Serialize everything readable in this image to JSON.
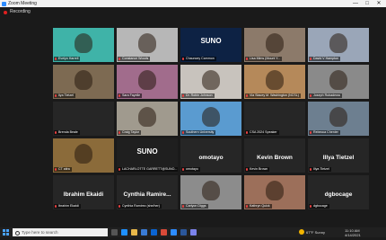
{
  "window": {
    "title": "Zoom Meeting",
    "minimize": "—",
    "maximize": "□",
    "close": "✕"
  },
  "recording": {
    "label": "Recording",
    "color": "#e02020"
  },
  "tiles": [
    {
      "name": "Evelyn Harrell",
      "kind": "photo",
      "bg": "#3fb3a8"
    },
    {
      "name": "Constance Woods",
      "kind": "photo",
      "bg": "#b7b7b7"
    },
    {
      "name": "Chauncey Cammon",
      "kind": "logo",
      "bg": "#0d2244",
      "logo": "SUNO"
    },
    {
      "name": "Lisa Mims (Mount Y...",
      "kind": "photo",
      "bg": "#8c7a6a"
    },
    {
      "name": "David V Hampton",
      "kind": "photo",
      "bg": "#9aa6b8"
    },
    {
      "name": "Ilya Tietzel",
      "kind": "photo",
      "bg": "#7d6a52"
    },
    {
      "name": "Sara Fayelle",
      "kind": "photo",
      "bg": "#a16c8c"
    },
    {
      "name": "Dr. Robin Johnson",
      "kind": "photo",
      "bg": "#c8c3bd"
    },
    {
      "name": "Via Stacey M. Washington (NCSL)",
      "kind": "photo",
      "bg": "#b5895a"
    },
    {
      "name": "Joseph Rubadewa",
      "kind": "photo",
      "bg": "#8a8a8a"
    },
    {
      "name": "Brenda Beale",
      "kind": "dark",
      "bg": "#1f1f1f"
    },
    {
      "name": "Craig Taylor",
      "kind": "photo",
      "bg": "#a09a8e"
    },
    {
      "name": "Southern University",
      "kind": "photo",
      "bg": "#5a9bd0"
    },
    {
      "name": "CSA 2024 Speaker",
      "kind": "dark",
      "bg": "#1f1f1f"
    },
    {
      "name": "Rebecca Chenier",
      "kind": "photo",
      "bg": "#6d7f90"
    },
    {
      "name": "CT atira",
      "kind": "photo",
      "bg": "#8b6b3a"
    },
    {
      "name": "LACHARLOTTE GARRETT@SUNO...",
      "kind": "logo",
      "bg": "#1f1f1f",
      "logo": "SUNO"
    },
    {
      "name": "omotayo",
      "kind": "name",
      "bg": "#1f1f1f",
      "big": "omotayo"
    },
    {
      "name": "Kevin Brown",
      "kind": "name",
      "bg": "#1f1f1f",
      "big": "Kevin Brown"
    },
    {
      "name": "Illya Tietzel",
      "kind": "name",
      "bg": "#1f1f1f",
      "big": "Illya Tietzel"
    },
    {
      "name": "Ibrahim Ekaidi",
      "kind": "name",
      "bg": "#1f1f1f",
      "big": "Ibrahim Ekaidi"
    },
    {
      "name": "Cynthia Ramirez (she/her)",
      "kind": "name",
      "bg": "#1f1f1f",
      "big": "Cynthia Ramire..."
    },
    {
      "name": "Carlyon Diggs",
      "kind": "photo",
      "bg": "#8c8c8c"
    },
    {
      "name": "Kathryn Quick",
      "kind": "photo",
      "bg": "#9c6f5a"
    },
    {
      "name": "dgbocage",
      "kind": "name",
      "bg": "#1f1f1f",
      "big": "dgbocage"
    }
  ],
  "taskbar": {
    "search_placeholder": "Type here to search",
    "weather": "67°F Sunny",
    "time": "11:10 AM",
    "date": "4/14/2021"
  }
}
